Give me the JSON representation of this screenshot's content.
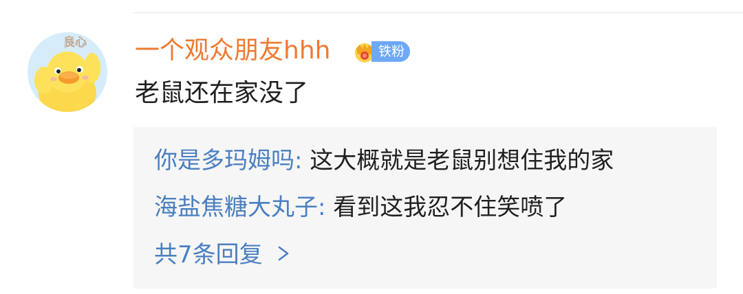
{
  "comment": {
    "username": "一个观众朋友hhh",
    "badge_label": "铁粉",
    "text": "老鼠还在家没了",
    "avatar_text": "良心"
  },
  "replies": [
    {
      "author": "你是多玛姆吗",
      "separator": ": ",
      "text": "这大概就是老鼠别想住我的家"
    },
    {
      "author": "海盐焦糖大丸子",
      "separator": ": ",
      "text": "看到这我忍不住笑喷了"
    }
  ],
  "more_replies": {
    "label": "共7条回复 "
  },
  "colors": {
    "username": "#ee7a2f",
    "reply_author": "#4a7fc1",
    "badge_bg": "#6ea9f7",
    "replies_bg": "#f6f6f6"
  },
  "icons": [
    "crown-icon",
    "chevron-right-icon"
  ]
}
